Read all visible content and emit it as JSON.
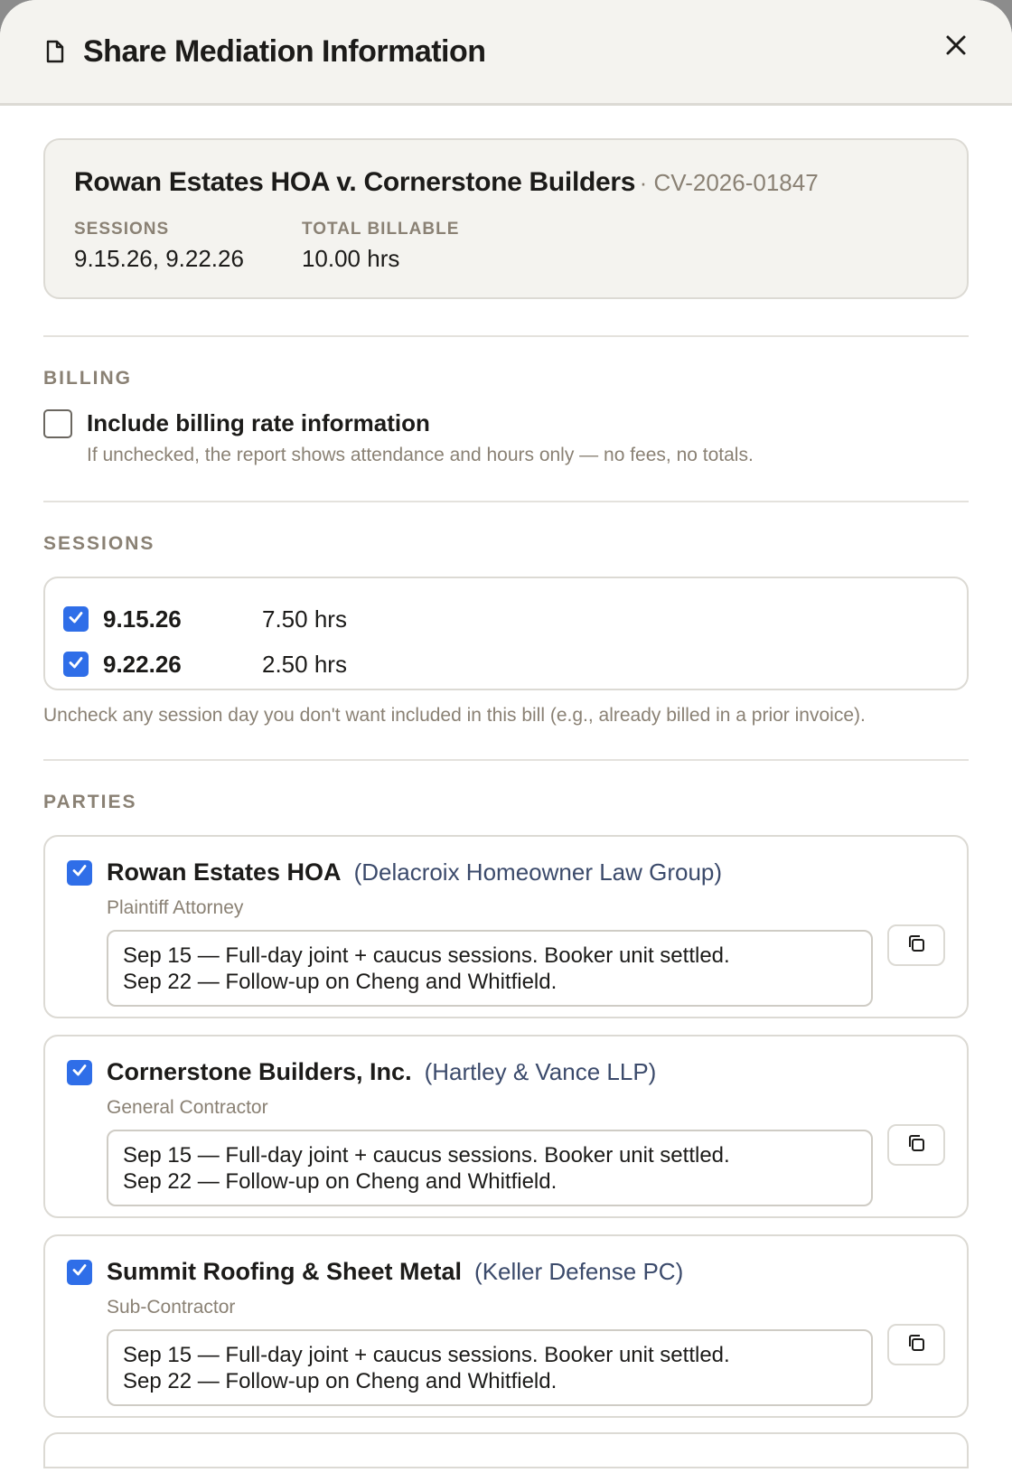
{
  "dialog": {
    "title": "Share Mediation Information",
    "icons": {
      "title_icon": "document-icon",
      "close_icon": "close-icon"
    }
  },
  "case": {
    "title": "Rowan Estates HOA v. Cornerstone Builders",
    "number": "· CV-2026-01847",
    "sessions_label": "SESSIONS",
    "sessions_value": "9.15.26, 9.22.26",
    "total_label": "TOTAL BILLABLE",
    "total_value": "10.00 hrs"
  },
  "billing": {
    "section_label": "BILLING",
    "checkbox_label": "Include billing rate information",
    "checked": false,
    "help": "If unchecked, the report shows attendance and hours only — no fees, no totals."
  },
  "sessions": {
    "section_label": "SESSIONS",
    "items": [
      {
        "date": "9.15.26",
        "hours": "7.50 hrs",
        "checked": true
      },
      {
        "date": "9.22.26",
        "hours": "2.50 hrs",
        "checked": true
      }
    ],
    "help": "Uncheck any session day you don't want included in this bill (e.g., already billed in a prior invoice)."
  },
  "parties": {
    "section_label": "PARTIES",
    "items": [
      {
        "name": "Rowan Estates HOA",
        "firm": "(Delacroix Homeowner Law Group)",
        "role": "Plaintiff Attorney",
        "notes": "Sep 15 — Full-day joint + caucus sessions. Booker unit settled.\nSep 22 — Follow-up on Cheng and Whitfield.",
        "checked": true
      },
      {
        "name": "Cornerstone Builders, Inc.",
        "firm": "(Hartley & Vance LLP)",
        "role": "General Contractor",
        "notes": "Sep 15 — Full-day joint + caucus sessions. Booker unit settled.\nSep 22 — Follow-up on Cheng and Whitfield.",
        "checked": true
      },
      {
        "name": "Summit Roofing & Sheet Metal",
        "firm": "(Keller Defense PC)",
        "role": "Sub-Contractor",
        "notes": "Sep 15 — Full-day joint + caucus sessions. Booker unit settled.\nSep 22 — Follow-up on Cheng and Whitfield.",
        "checked": true
      }
    ]
  },
  "colors": {
    "accent": "#2f6ee8",
    "muted_text": "#8a8174",
    "firm_text": "#3b4a6b",
    "panel_bg": "#f4f3ef",
    "border": "#dcdad4"
  }
}
